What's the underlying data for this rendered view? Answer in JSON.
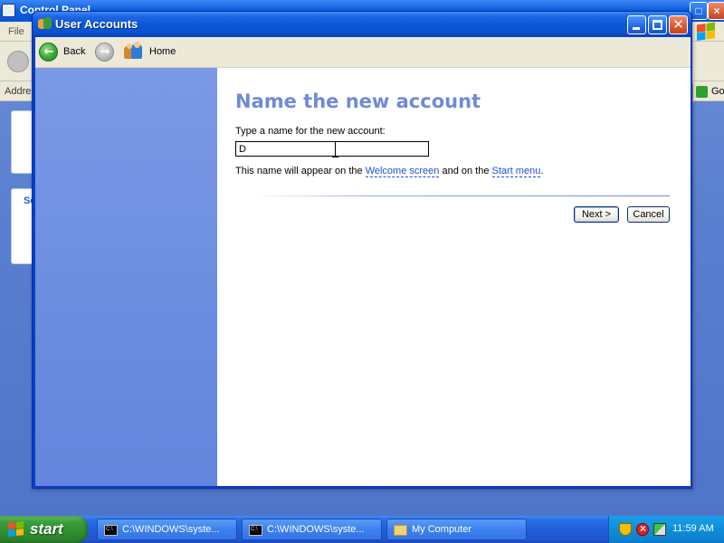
{
  "background_window": {
    "title": "Control Panel",
    "menu_first": "File",
    "address_label": "Address",
    "go_label": "Go",
    "side_task_initial": "Se"
  },
  "window": {
    "title": "User Accounts"
  },
  "toolbar": {
    "back_label": "Back",
    "home_label": "Home"
  },
  "main": {
    "heading": "Name the new account",
    "prompt": "Type a name for the new account:",
    "name_value": "D",
    "info_prefix": "This name will appear on the ",
    "welcome_link": "Welcome screen",
    "info_mid": " and on the ",
    "start_menu_link": "Start menu",
    "info_suffix": ".",
    "next_label": "Next >",
    "cancel_label": "Cancel"
  },
  "taskbar": {
    "start_label": "start",
    "tasks": [
      {
        "label": "C:\\WINDOWS\\syste...",
        "icon": "cmd-icon"
      },
      {
        "label": "C:\\WINDOWS\\syste...",
        "icon": "cmd-icon"
      },
      {
        "label": "My Computer",
        "icon": "folder-icon"
      }
    ],
    "clock": "11:59 AM"
  }
}
